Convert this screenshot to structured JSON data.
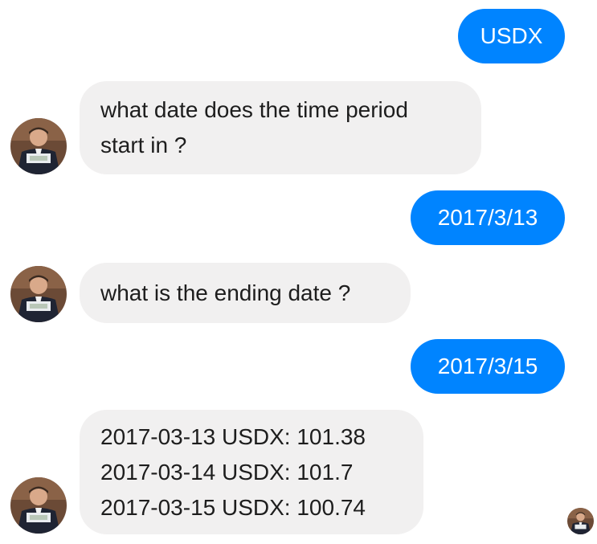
{
  "messages": [
    {
      "sender": "me",
      "text": "USDX"
    },
    {
      "sender": "bot",
      "lines": [
        "what date does the time period",
        "start in ?"
      ]
    },
    {
      "sender": "me",
      "text": "2017/3/13"
    },
    {
      "sender": "bot",
      "lines": [
        "what is the ending date ?"
      ]
    },
    {
      "sender": "me",
      "text": "2017/3/15"
    },
    {
      "sender": "bot",
      "lines": [
        "2017-03-13 USDX: 101.38",
        "2017-03-14 USDX: 101.7",
        "2017-03-15 USDX: 100.74"
      ]
    }
  ],
  "colors": {
    "outgoing_bubble": "#0084ff",
    "incoming_bubble": "#f1f0f0",
    "outgoing_text": "#ffffff",
    "incoming_text": "#1d1d1d"
  },
  "icons": {
    "bot_avatar": "man-in-suit-holding-banknote-avatar",
    "read_receipt": "read-receipt-avatar"
  }
}
